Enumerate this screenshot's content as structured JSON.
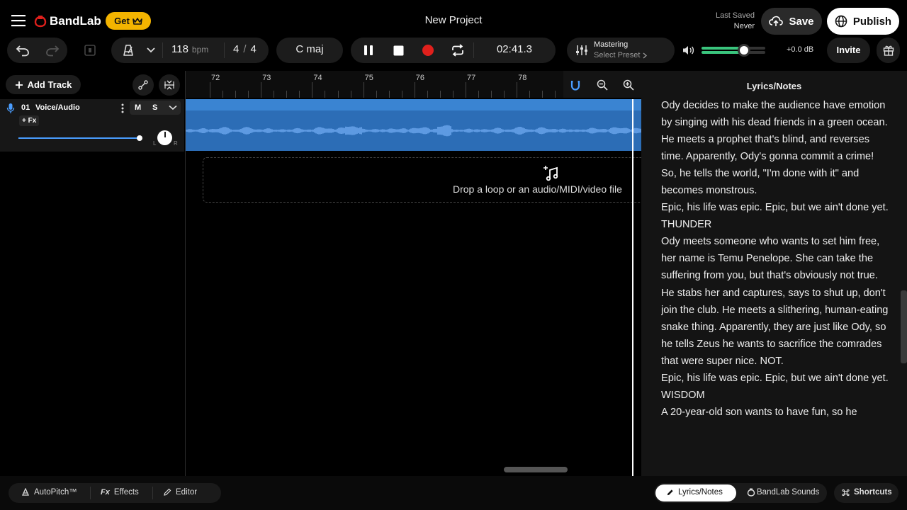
{
  "header": {
    "brand": "BandLab",
    "get_label": "Get",
    "project_title": "New Project",
    "last_saved_label": "Last Saved",
    "last_saved_value": "Never",
    "save_label": "Save",
    "publish_label": "Publish"
  },
  "toolbar": {
    "tempo": "118",
    "tempo_unit": "bpm",
    "time_sig_num": "4",
    "time_sig_sep": "/",
    "time_sig_den": "4",
    "key": "C maj",
    "time": "02:41.3",
    "mastering_label": "Mastering",
    "mastering_preset": "Select Preset",
    "volume_db": "+0.0 dB",
    "invite_label": "Invite",
    "record_color": "#e0201c"
  },
  "tracks_panel": {
    "add_track_label": "Add Track",
    "tracks": [
      {
        "number": "01",
        "name": "Voice/Audio",
        "mute_label": "M",
        "solo_label": "S",
        "fx_label": "+ Fx",
        "pan_left": "L",
        "pan_right": "R"
      }
    ]
  },
  "timeline": {
    "bars": [
      "72",
      "73",
      "74",
      "75",
      "76",
      "77",
      "78"
    ],
    "drop_text": "Drop a loop or an audio/MIDI/video file",
    "clip_color": "#2c6db6"
  },
  "lyrics": {
    "title": "Lyrics/Notes",
    "lines": [
      "Ody decides to make the audience have emotion by singing with his dead friends in a green ocean. He meets a prophet that's blind, and reverses time. Apparently, Ody's gonna commit a crime! So, he tells the world, \"I'm done with it\" and becomes monstrous.",
      "Epic, his life was epic. Epic, but we ain't done yet.",
      "THUNDER",
      "Ody meets someone who wants to set him free, her name is Temu Penelope. She can take the suffering from you, but that's obviously not true. He stabs her and captures, says to shut up, don't join the club. He meets a slithering, human-eating snake thing. Apparently, they are just like Ody, so he tells Zeus he wants to sacrifice the comrades that were super nice. NOT.",
      "Epic, his life was epic. Epic, but we ain't done yet.",
      "WISDOM",
      "A 20-year-old son wants to have fun, so he"
    ]
  },
  "bottom": {
    "autopitch_label": "AutoPitch™",
    "effects_label": "Effects",
    "editor_label": "Editor",
    "lyrics_tab_label": "Lyrics/Notes",
    "sounds_tab_label": "BandLab Sounds",
    "shortcuts_label": "Shortcuts"
  }
}
